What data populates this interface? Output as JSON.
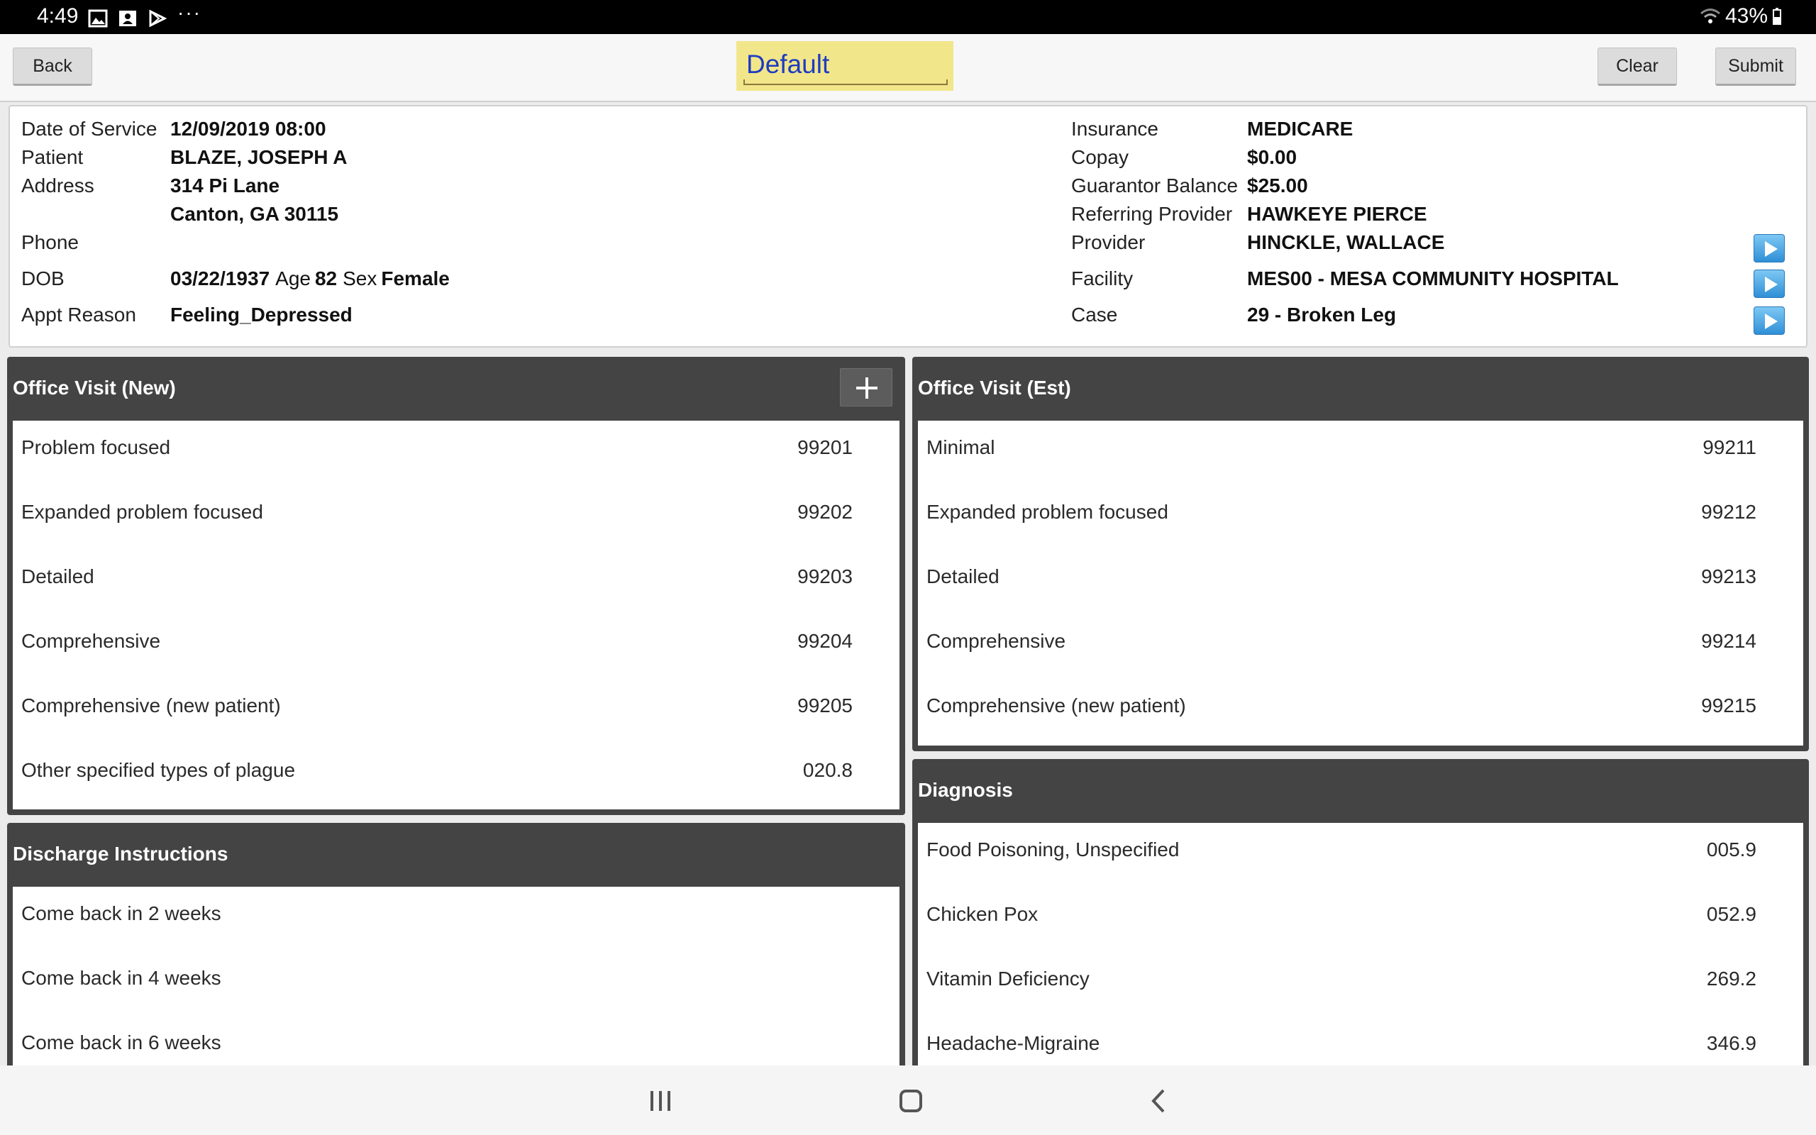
{
  "status_bar": {
    "time": "4:49",
    "more": "···",
    "battery": "43%"
  },
  "toolbar": {
    "back_label": "Back",
    "template_value": "Default",
    "clear_label": "Clear",
    "submit_label": "Submit"
  },
  "patient": {
    "date_of_service_label": "Date of Service",
    "date_of_service": "12/09/2019 08:00",
    "patient_label": "Patient",
    "patient_name": "BLAZE, JOSEPH A",
    "address_label": "Address",
    "address_line1": "314 Pi Lane",
    "address_line2": "Canton, GA 30115",
    "phone_label": "Phone",
    "phone": "",
    "dob_label": "DOB",
    "dob": "03/22/1937",
    "age_label": "Age",
    "age": "82",
    "sex_label": "Sex",
    "sex": "Female",
    "appt_reason_label": "Appt Reason",
    "appt_reason": "Feeling_Depressed",
    "insurance_label": "Insurance",
    "insurance": "MEDICARE",
    "copay_label": "Copay",
    "copay": "$0.00",
    "guarantor_balance_label": "Guarantor Balance",
    "guarantor_balance": "$25.00",
    "referring_provider_label": "Referring Provider",
    "referring_provider": "HAWKEYE PIERCE",
    "provider_label": "Provider",
    "provider": "HINCKLE, WALLACE",
    "facility_label": "Facility",
    "facility": "MES00 - MESA COMMUNITY HOSPITAL",
    "case_label": "Case",
    "case": "29 - Broken Leg"
  },
  "office_visit_new": {
    "title": "Office Visit (New)",
    "items": [
      {
        "label": "Problem focused",
        "code": "99201"
      },
      {
        "label": "Expanded problem focused",
        "code": "99202"
      },
      {
        "label": "Detailed",
        "code": "99203"
      },
      {
        "label": "Comprehensive",
        "code": "99204"
      },
      {
        "label": "Comprehensive (new patient)",
        "code": "99205"
      },
      {
        "label": "Other specified types of plague",
        "code": "020.8"
      }
    ]
  },
  "office_visit_est": {
    "title": "Office Visit (Est)",
    "items": [
      {
        "label": "Minimal",
        "code": "99211"
      },
      {
        "label": "Expanded problem focused",
        "code": "99212"
      },
      {
        "label": "Detailed",
        "code": "99213"
      },
      {
        "label": "Comprehensive",
        "code": "99214"
      },
      {
        "label": "Comprehensive (new patient)",
        "code": "99215"
      }
    ]
  },
  "discharge": {
    "title": "Discharge Instructions",
    "items": [
      {
        "label": "Come back in 2 weeks"
      },
      {
        "label": "Come back in 4 weeks"
      },
      {
        "label": "Come back in 6 weeks"
      }
    ]
  },
  "diagnosis": {
    "title": "Diagnosis",
    "items": [
      {
        "label": "Food Poisoning, Unspecified",
        "code": "005.9"
      },
      {
        "label": "Chicken Pox",
        "code": "052.9"
      },
      {
        "label": "Vitamin Deficiency",
        "code": "269.2"
      },
      {
        "label": "Headache-Migraine",
        "code": "346.9"
      }
    ]
  },
  "colors": {
    "panel_header": "#444444",
    "template_bg": "#f2e68a",
    "template_text": "#1d3cc2",
    "arrow_button": "#2f8fd6"
  }
}
